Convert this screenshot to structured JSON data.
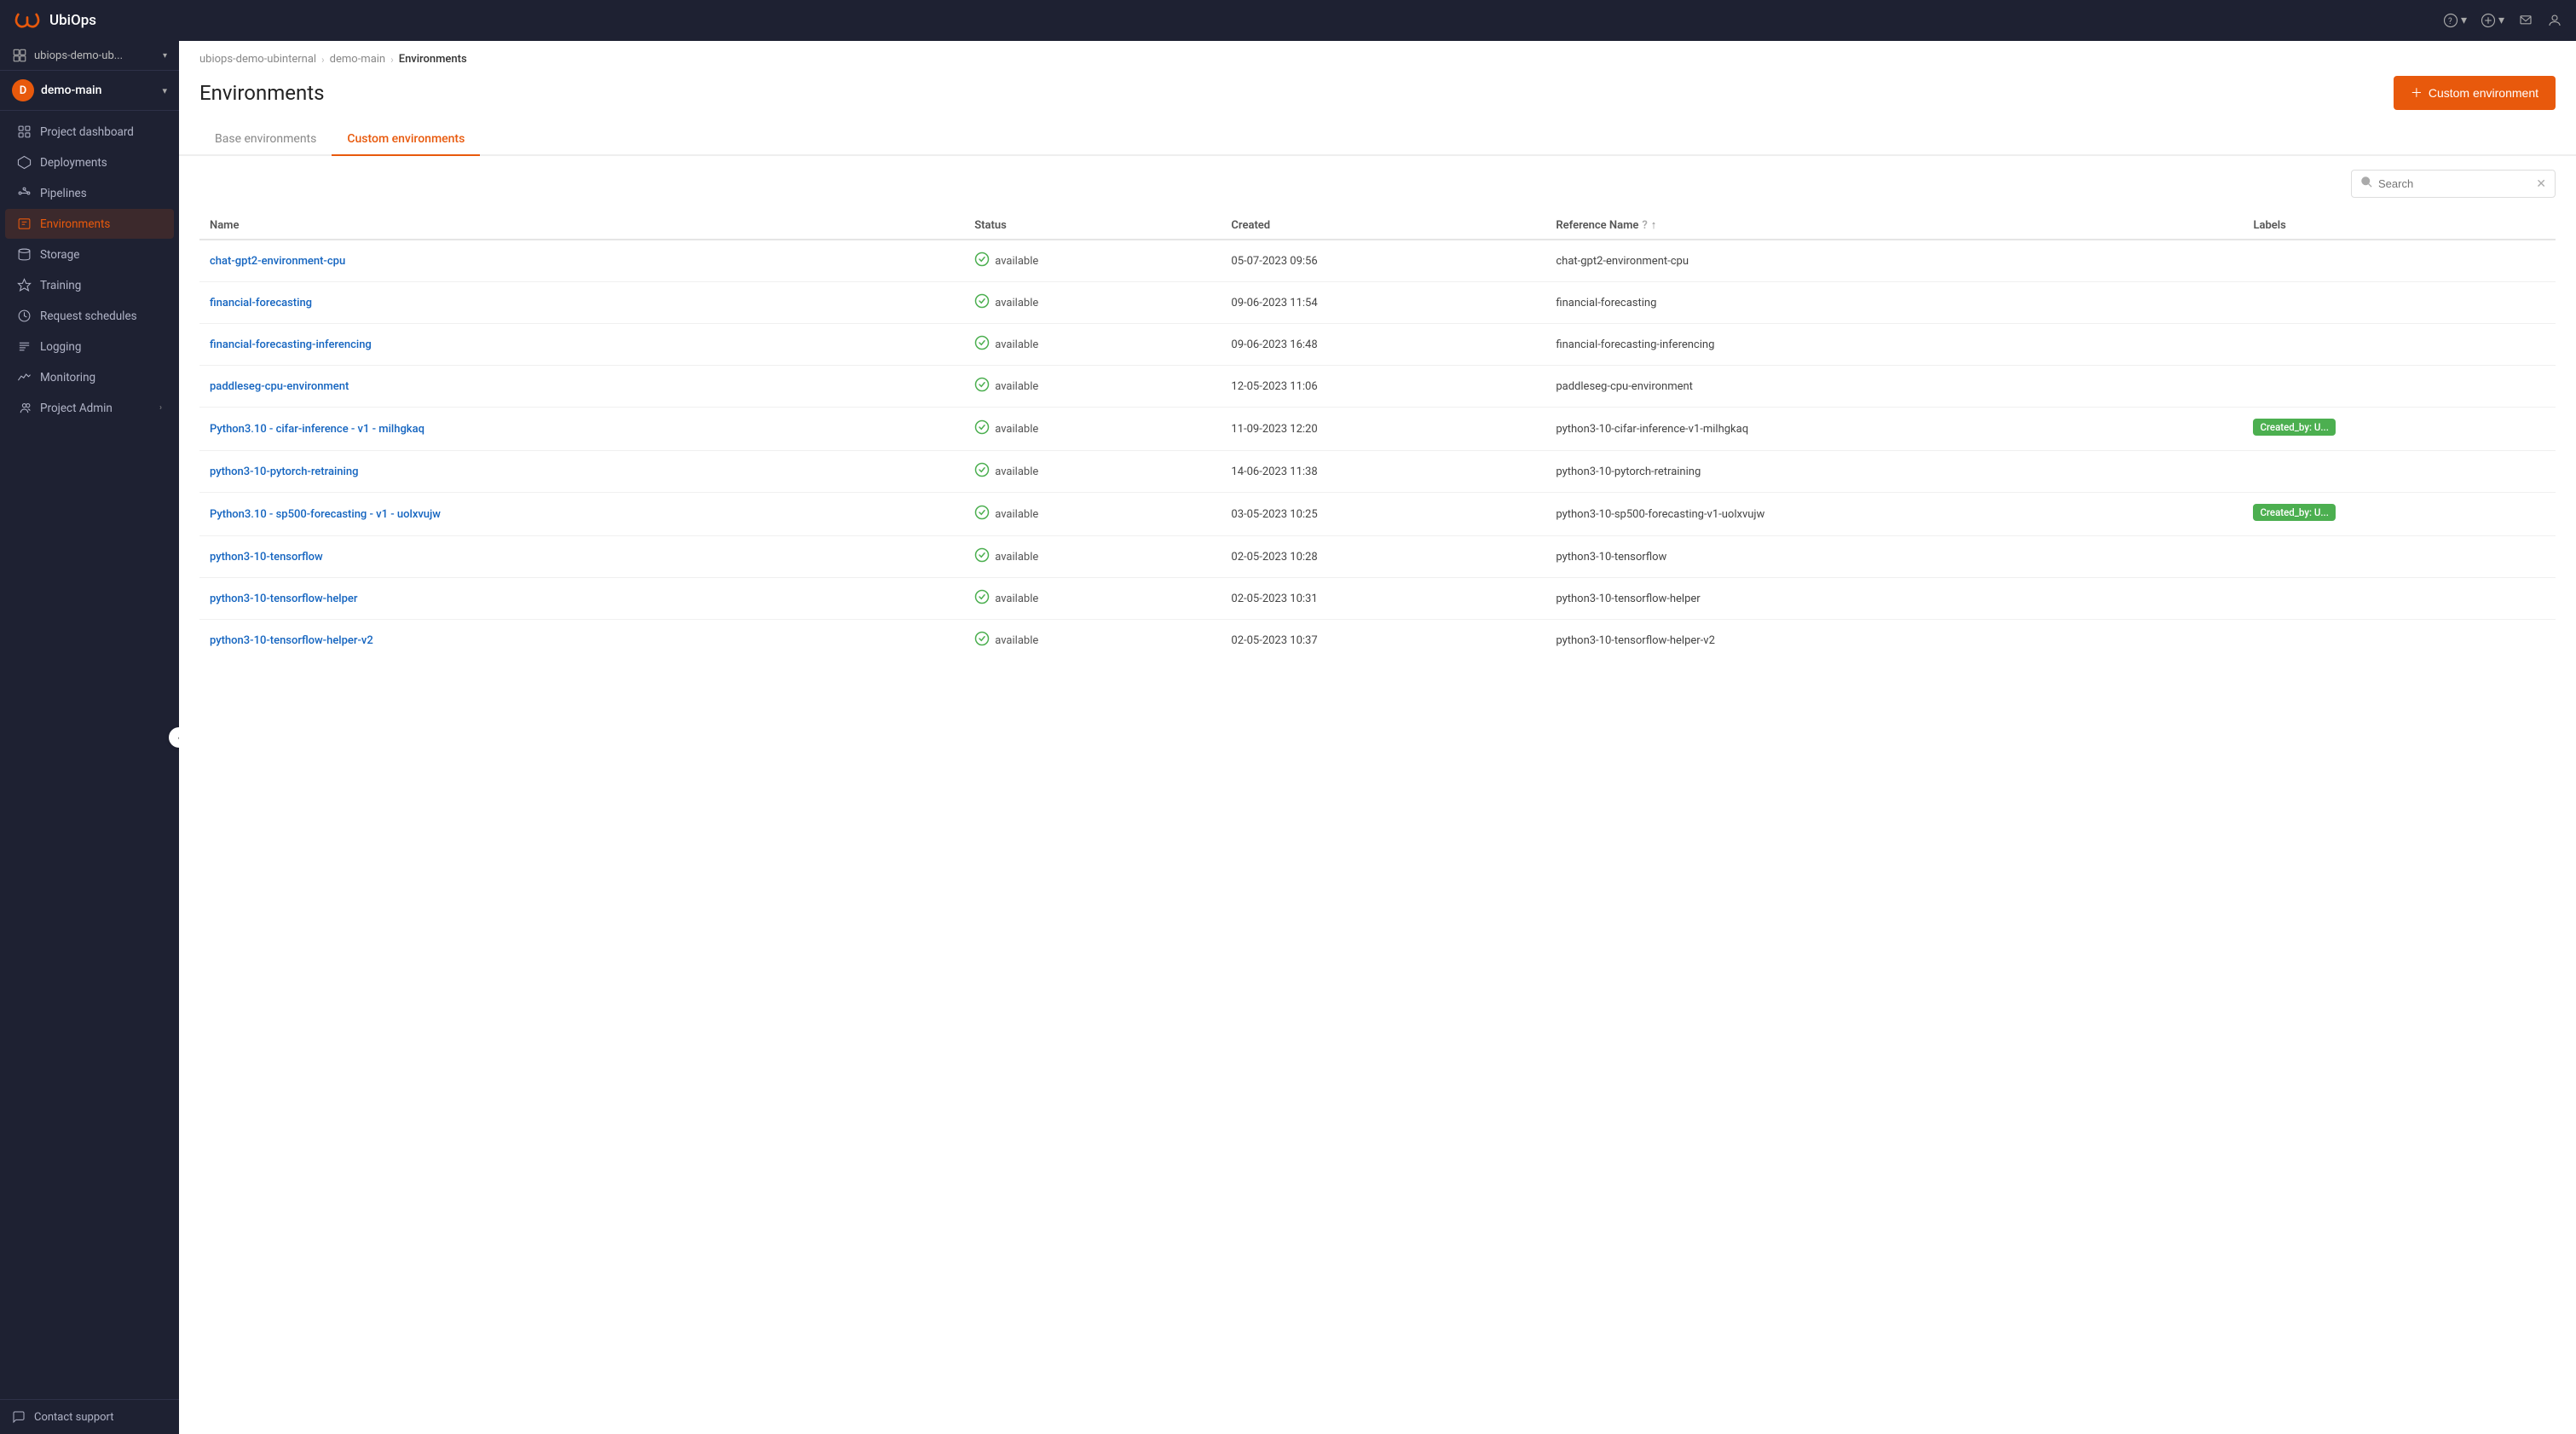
{
  "app": {
    "title": "UbiOps"
  },
  "topnav": {
    "help_label": "?",
    "plus_label": "+",
    "notifications_icon": "bell",
    "user_icon": "user"
  },
  "sidebar": {
    "org_name": "ubiops-demo-ub...",
    "project_name": "demo-main",
    "project_initial": "D",
    "items": [
      {
        "id": "project-dashboard",
        "label": "Project dashboard",
        "icon": "grid"
      },
      {
        "id": "deployments",
        "label": "Deployments",
        "icon": "deployments"
      },
      {
        "id": "pipelines",
        "label": "Pipelines",
        "icon": "pipelines"
      },
      {
        "id": "environments",
        "label": "Environments",
        "icon": "environments",
        "active": true
      },
      {
        "id": "storage",
        "label": "Storage",
        "icon": "storage"
      },
      {
        "id": "training",
        "label": "Training",
        "icon": "training"
      },
      {
        "id": "request-schedules",
        "label": "Request schedules",
        "icon": "schedules"
      },
      {
        "id": "logging",
        "label": "Logging",
        "icon": "logging"
      },
      {
        "id": "monitoring",
        "label": "Monitoring",
        "icon": "monitoring"
      },
      {
        "id": "project-admin",
        "label": "Project Admin",
        "icon": "admin",
        "has_chevron": true
      }
    ],
    "contact_support": "Contact support"
  },
  "breadcrumb": {
    "items": [
      {
        "label": "ubiops-demo-ubinternal",
        "href": "#"
      },
      {
        "label": "demo-main",
        "href": "#"
      },
      {
        "label": "Environments"
      }
    ]
  },
  "page": {
    "title": "Environments",
    "btn_custom_env": "+ Custom environment",
    "tabs": [
      {
        "id": "base",
        "label": "Base environments"
      },
      {
        "id": "custom",
        "label": "Custom environments",
        "active": true
      }
    ]
  },
  "search": {
    "placeholder": "Search",
    "value": ""
  },
  "table": {
    "columns": [
      {
        "id": "name",
        "label": "Name"
      },
      {
        "id": "status",
        "label": "Status"
      },
      {
        "id": "created",
        "label": "Created"
      },
      {
        "id": "reference_name",
        "label": "Reference Name",
        "has_help": true,
        "has_sort": true
      },
      {
        "id": "labels",
        "label": "Labels"
      }
    ],
    "rows": [
      {
        "name": "chat-gpt2-environment-cpu",
        "name_link": true,
        "status": "available",
        "created": "05-07-2023 09:56",
        "reference_name": "chat-gpt2-environment-cpu",
        "label": ""
      },
      {
        "name": "financial-forecasting",
        "name_link": true,
        "status": "available",
        "created": "09-06-2023 11:54",
        "reference_name": "financial-forecasting",
        "label": ""
      },
      {
        "name": "financial-forecasting-inferencing",
        "name_link": true,
        "status": "available",
        "created": "09-06-2023 16:48",
        "reference_name": "financial-forecasting-inferencing",
        "label": ""
      },
      {
        "name": "paddleseg-cpu-environment",
        "name_link": false,
        "status": "available",
        "created": "12-05-2023 11:06",
        "reference_name": "paddleseg-cpu-environment",
        "label": ""
      },
      {
        "name": "Python3.10 - cifar-inference - v1 - milhgkaq",
        "name_link": false,
        "status": "available",
        "created": "11-09-2023 12:20",
        "reference_name": "python3-10-cifar-inference-v1-milhgkaq",
        "label": "Created_by: U..."
      },
      {
        "name": "python3-10-pytorch-retraining",
        "name_link": false,
        "status": "available",
        "created": "14-06-2023 11:38",
        "reference_name": "python3-10-pytorch-retraining",
        "label": ""
      },
      {
        "name": "Python3.10 - sp500-forecasting - v1 - uolxvujw",
        "name_link": false,
        "status": "available",
        "created": "03-05-2023 10:25",
        "reference_name": "python3-10-sp500-forecasting-v1-uolxvujw",
        "label": "Created_by: U..."
      },
      {
        "name": "python3-10-tensorflow",
        "name_link": false,
        "status": "available",
        "created": "02-05-2023 10:28",
        "reference_name": "python3-10-tensorflow",
        "label": ""
      },
      {
        "name": "python3-10-tensorflow-helper",
        "name_link": false,
        "status": "available",
        "created": "02-05-2023 10:31",
        "reference_name": "python3-10-tensorflow-helper",
        "label": ""
      },
      {
        "name": "python3-10-tensorflow-helper-v2",
        "name_link": false,
        "status": "available",
        "created": "02-05-2023 10:37",
        "reference_name": "python3-10-tensorflow-helper-v2",
        "label": ""
      }
    ]
  }
}
